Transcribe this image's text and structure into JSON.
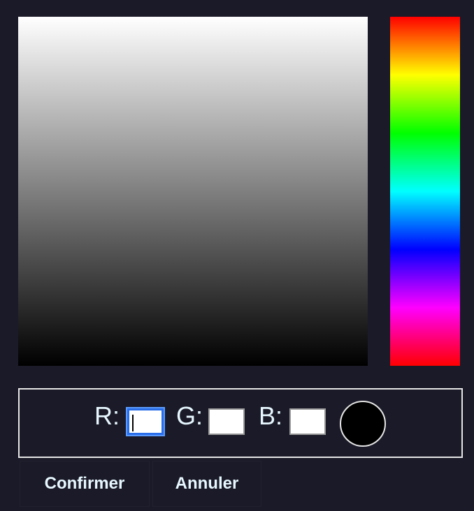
{
  "color_picker": {
    "fields": {
      "r": {
        "label": "R:",
        "value": ""
      },
      "g": {
        "label": "G:",
        "value": ""
      },
      "b": {
        "label": "B:",
        "value": ""
      }
    },
    "preview_color": "#000000"
  },
  "actions": {
    "confirm_label": "Confirmer",
    "cancel_label": "Annuler"
  }
}
